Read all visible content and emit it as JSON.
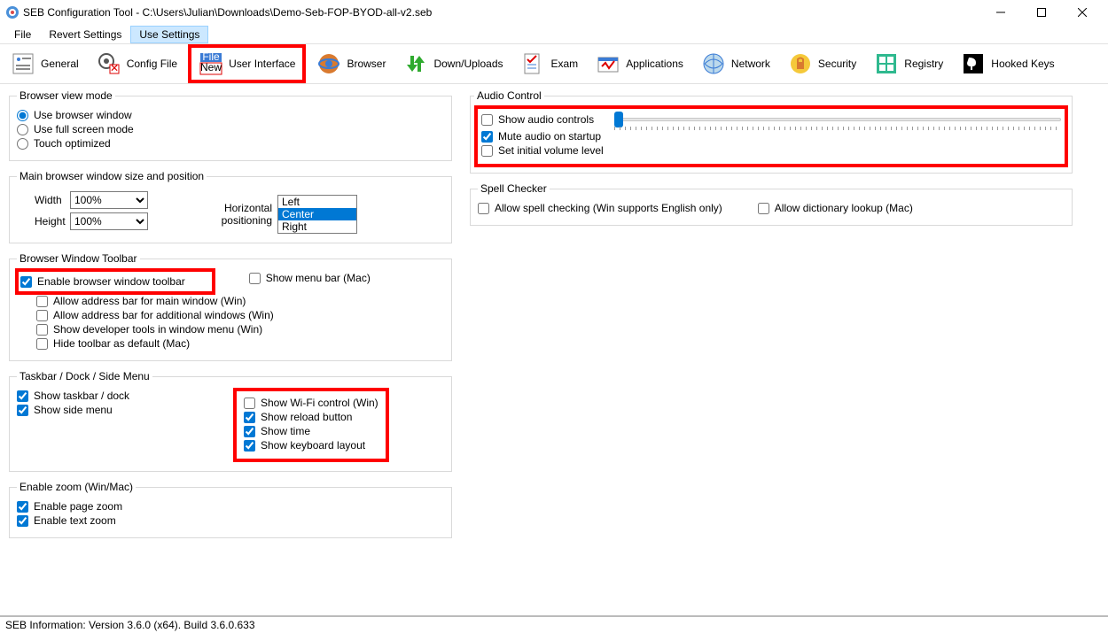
{
  "window": {
    "title": "SEB Configuration Tool - C:\\Users\\Julian\\Downloads\\Demo-Seb-FOP-BYOD-all-v2.seb"
  },
  "menu": {
    "file": "File",
    "revert": "Revert Settings",
    "use": "Use Settings"
  },
  "tabs": {
    "general": "General",
    "config": "Config File",
    "ui": "User Interface",
    "browser": "Browser",
    "down": "Down/Uploads",
    "exam": "Exam",
    "apps": "Applications",
    "network": "Network",
    "security": "Security",
    "registry": "Registry",
    "hooked": "Hooked Keys"
  },
  "viewmode": {
    "legend": "Browser view mode",
    "use_browser_window": "Use browser window",
    "use_full_screen": "Use full screen mode",
    "touch_optimized": "Touch optimized"
  },
  "mainwin": {
    "legend": "Main browser window size and position",
    "width": "Width",
    "height": "Height",
    "width_val": "100%",
    "height_val": "100%",
    "hpos": "Horizontal positioning",
    "opts": {
      "left": "Left",
      "center": "Center",
      "right": "Right"
    }
  },
  "toolbar": {
    "legend": "Browser Window Toolbar",
    "enable": "Enable browser window toolbar",
    "menubar": "Show menu bar (Mac)",
    "addr_main": "Allow address bar for main window (Win)",
    "addr_add": "Allow address bar for additional windows (Win)",
    "dev": "Show developer tools in window menu (Win)",
    "hide": "Hide toolbar as default (Mac)"
  },
  "taskbar": {
    "legend": "Taskbar / Dock / Side Menu",
    "show_taskbar": "Show taskbar / dock",
    "show_side": "Show side menu",
    "wifi": "Show Wi-Fi control (Win)",
    "reload": "Show reload button",
    "time": "Show time",
    "keyboard": "Show keyboard layout"
  },
  "zoom": {
    "legend": "Enable zoom (Win/Mac)",
    "page": "Enable page zoom",
    "text": "Enable text zoom"
  },
  "audio": {
    "legend": "Audio Control",
    "controls": "Show audio controls",
    "mute": "Mute audio on startup",
    "initial": "Set initial volume level",
    "slider_value": 0
  },
  "spell": {
    "legend": "Spell Checker",
    "allow": "Allow spell checking (Win supports English only)",
    "dict": "Allow dictionary lookup (Mac)"
  },
  "status": "SEB Information: Version 3.6.0 (x64). Build 3.6.0.633"
}
